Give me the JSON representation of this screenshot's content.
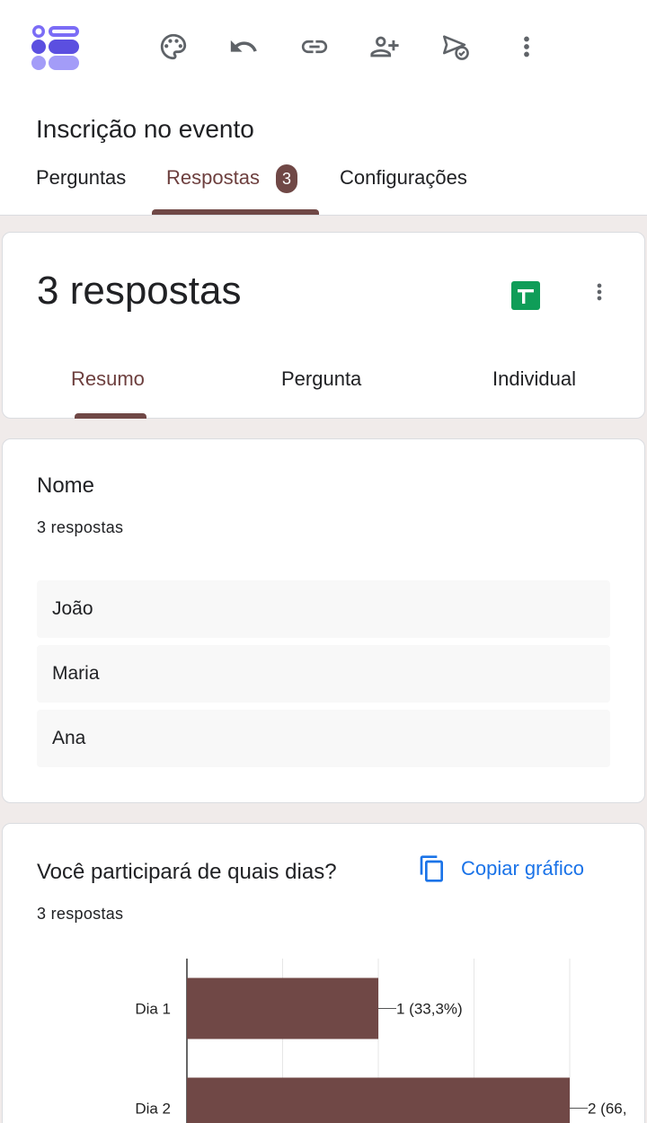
{
  "app": {
    "form_title": "Inscrição no evento",
    "toolbar_icons": [
      "palette-icon",
      "undo-icon",
      "link-icon",
      "add-collaborator-icon",
      "send-icon",
      "more-vert-icon"
    ],
    "accent_color": "#704846",
    "link_color": "#1a73e8"
  },
  "tabs": {
    "perguntas": "Perguntas",
    "respostas": "Respostas",
    "respostas_badge": "3",
    "configuracoes": "Configurações",
    "active": "Respostas"
  },
  "summary": {
    "count_label": "3 respostas",
    "subtabs": [
      "Resumo",
      "Pergunta",
      "Individual"
    ],
    "active_subtab": "Resumo"
  },
  "questions": [
    {
      "title": "Nome",
      "count": "3 respostas",
      "answers": [
        "João",
        "Maria",
        "Ana"
      ]
    },
    {
      "title": "Você participará de quais dias?",
      "count": "3 respostas",
      "copy_label": "Copiar gráfico"
    }
  ],
  "chart_data": {
    "type": "bar",
    "orientation": "horizontal",
    "categories": [
      "Dia 1",
      "Dia 2"
    ],
    "values": [
      1,
      2
    ],
    "data_labels": [
      "1 (33,3%)",
      "2 (66,"
    ],
    "xlim": [
      0,
      2
    ],
    "grid": true,
    "color": "#704846"
  }
}
